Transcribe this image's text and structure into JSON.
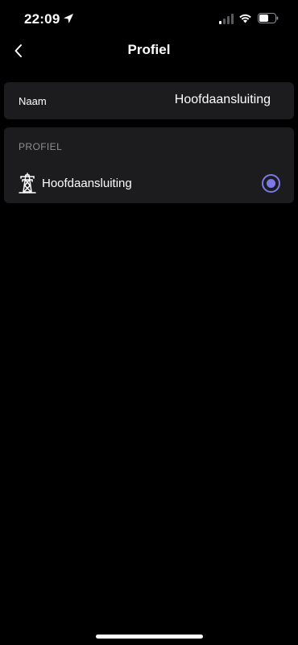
{
  "status_bar": {
    "time": "22:09"
  },
  "nav": {
    "title": "Profiel"
  },
  "name_row": {
    "label": "Naam",
    "value": "Hoofdaansluiting"
  },
  "profile_section": {
    "header": "PROFIEL",
    "options": [
      {
        "label": "Hoofdaansluiting",
        "icon": "power-pylon-icon",
        "selected": true
      }
    ]
  },
  "colors": {
    "background": "#000000",
    "card": "#1c1c1e",
    "accent": "#7b78e8",
    "secondary_text": "#8e8e93"
  }
}
